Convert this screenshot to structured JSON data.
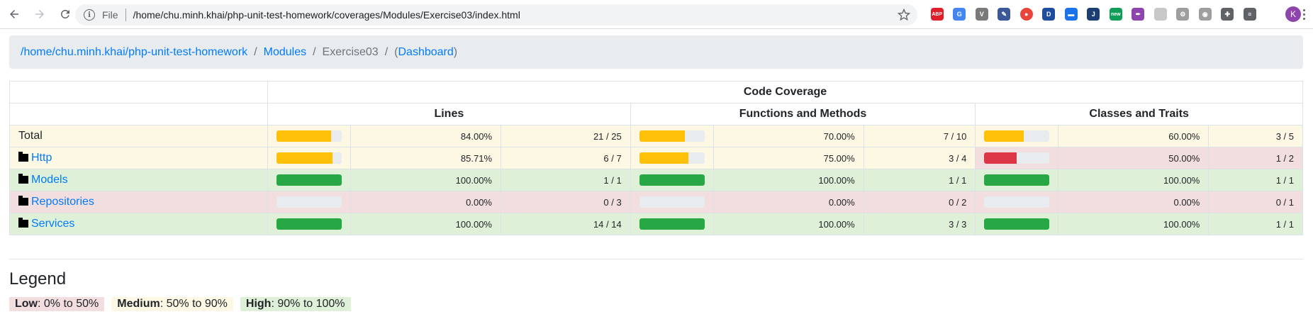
{
  "browser": {
    "protocol_label": "File",
    "url": "/home/chu.minh.khai/php-unit-test-homework/coverages/Modules/Exercise03/index.html",
    "avatar_letter": "K",
    "extensions": [
      {
        "name": "adblock-plus-icon",
        "color": "#e01e2a",
        "label": "ABP"
      },
      {
        "name": "translate-icon",
        "color": "#4285f4",
        "label": "G"
      },
      {
        "name": "vue-devtools-icon",
        "color": "#7a7a7a",
        "label": "V"
      },
      {
        "name": "eyedropper-icon",
        "color": "#3b5998",
        "label": "✎"
      },
      {
        "name": "color-wheel-icon",
        "color": "#e8453c",
        "label": "●"
      },
      {
        "name": "d-extension-icon",
        "color": "#1d4e9e",
        "label": "D"
      },
      {
        "name": "window-extension-icon",
        "color": "#1a73e8",
        "label": "▬"
      },
      {
        "name": "j-extension-icon",
        "color": "#1b3e75",
        "label": "J"
      },
      {
        "name": "new-extension-icon",
        "color": "#0f9d58",
        "label": "new"
      },
      {
        "name": "feather-icon",
        "color": "#8e44ad",
        "label": "✒"
      },
      {
        "name": "blank-extension-icon",
        "color": "#c8c8c8",
        "label": ""
      },
      {
        "name": "bicycle-icon",
        "color": "#9e9e9e",
        "label": "⚙"
      },
      {
        "name": "owl-icon",
        "color": "#9e9e9e",
        "label": "◉"
      },
      {
        "name": "extensions-puzzle-icon",
        "color": "#5f6368",
        "label": "✚"
      },
      {
        "name": "reading-list-icon",
        "color": "#5f6368",
        "label": "≡"
      }
    ]
  },
  "breadcrumb": {
    "root": "/home/chu.minh.khai/php-unit-test-homework",
    "modules": "Modules",
    "current": "Exercise03",
    "dashboard_open": "(",
    "dashboard": "Dashboard",
    "dashboard_close": ")",
    "separator": "/"
  },
  "table": {
    "group_header": "Code Coverage",
    "columns": [
      "Lines",
      "Functions and Methods",
      "Classes and Traits"
    ],
    "rows": [
      {
        "name": "Total",
        "is_folder": false,
        "lines": {
          "percent_label": "84.00%",
          "ratio": "21 / 25",
          "value": 84.0,
          "level": "warning"
        },
        "functions": {
          "percent_label": "70.00%",
          "ratio": "7 / 10",
          "value": 70.0,
          "level": "warning"
        },
        "classes": {
          "percent_label": "60.00%",
          "ratio": "3 / 5",
          "value": 60.0,
          "level": "warning"
        }
      },
      {
        "name": "Http",
        "is_folder": true,
        "lines": {
          "percent_label": "85.71%",
          "ratio": "6 / 7",
          "value": 85.71,
          "level": "warning"
        },
        "functions": {
          "percent_label": "75.00%",
          "ratio": "3 / 4",
          "value": 75.0,
          "level": "warning"
        },
        "classes": {
          "percent_label": "50.00%",
          "ratio": "1 / 2",
          "value": 50.0,
          "level": "danger"
        }
      },
      {
        "name": "Models",
        "is_folder": true,
        "lines": {
          "percent_label": "100.00%",
          "ratio": "1 / 1",
          "value": 100.0,
          "level": "success"
        },
        "functions": {
          "percent_label": "100.00%",
          "ratio": "1 / 1",
          "value": 100.0,
          "level": "success"
        },
        "classes": {
          "percent_label": "100.00%",
          "ratio": "1 / 1",
          "value": 100.0,
          "level": "success"
        }
      },
      {
        "name": "Repositories",
        "is_folder": true,
        "lines": {
          "percent_label": "0.00%",
          "ratio": "0 / 3",
          "value": 0.0,
          "level": "danger"
        },
        "functions": {
          "percent_label": "0.00%",
          "ratio": "0 / 2",
          "value": 0.0,
          "level": "danger"
        },
        "classes": {
          "percent_label": "0.00%",
          "ratio": "0 / 1",
          "value": 0.0,
          "level": "danger"
        }
      },
      {
        "name": "Services",
        "is_folder": true,
        "lines": {
          "percent_label": "100.00%",
          "ratio": "14 / 14",
          "value": 100.0,
          "level": "success"
        },
        "functions": {
          "percent_label": "100.00%",
          "ratio": "3 / 3",
          "value": 100.0,
          "level": "success"
        },
        "classes": {
          "percent_label": "100.00%",
          "ratio": "1 / 1",
          "value": 100.0,
          "level": "success"
        }
      }
    ]
  },
  "colors": {
    "bar_success": "#28a745",
    "bar_warning": "#ffc107",
    "bar_danger": "#dc3545",
    "link": "#007bff"
  },
  "legend": {
    "title": "Legend",
    "low_label": "Low",
    "low_range": ": 0% to 50%",
    "medium_label": "Medium",
    "medium_range": ": 50% to 90%",
    "high_label": "High",
    "high_range": ": 90% to 100%"
  }
}
